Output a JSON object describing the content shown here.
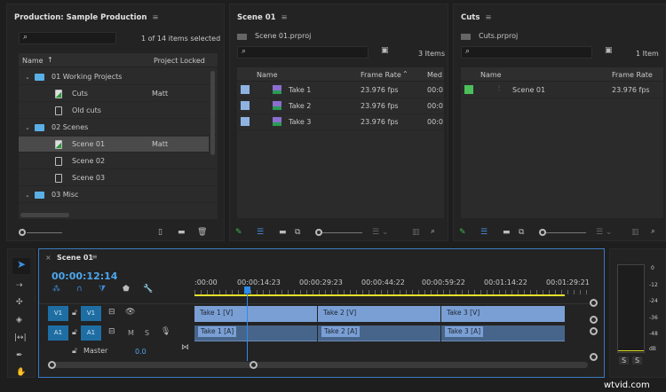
{
  "project_panel": {
    "title": "Production: Sample Production",
    "status": "1 of 14 items selected",
    "columns": [
      "Name",
      "Project Locked"
    ],
    "items": [
      {
        "label": "01 Working Projects",
        "type": "folder",
        "locked": ""
      },
      {
        "label": "Cuts",
        "type": "project-locked",
        "locked": "Matt"
      },
      {
        "label": "Old cuts",
        "type": "project",
        "locked": ""
      },
      {
        "label": "02 Scenes",
        "type": "folder",
        "locked": ""
      },
      {
        "label": "Scene 01",
        "type": "project-locked",
        "locked": "Matt",
        "selected": true
      },
      {
        "label": "Scene 02",
        "type": "project",
        "locked": ""
      },
      {
        "label": "Scene 03",
        "type": "project",
        "locked": ""
      },
      {
        "label": "03 Misc",
        "type": "folder",
        "locked": ""
      }
    ]
  },
  "scene_panel": {
    "title": "Scene 01",
    "file": "Scene 01.prproj",
    "count": "3 Items",
    "columns": [
      "Name",
      "Frame Rate",
      "Med"
    ],
    "rows": [
      {
        "name": "Take 1",
        "fps": "23.976 fps",
        "media": "00:0"
      },
      {
        "name": "Take 2",
        "fps": "23.976 fps",
        "media": "00:0"
      },
      {
        "name": "Take 3",
        "fps": "23.976 fps",
        "media": "00:0"
      }
    ],
    "label_color": "#8fb3e0"
  },
  "cuts_panel": {
    "title": "Cuts",
    "file": "Cuts.prproj",
    "count": "1 Item",
    "columns": [
      "Name",
      "Frame Rate"
    ],
    "rows": [
      {
        "name": "Scene 01",
        "fps": "23.976 fps"
      }
    ],
    "label_color": "#4cbf5a"
  },
  "timeline": {
    "tab": "Scene 01",
    "close": "×",
    "timecode": "00:00:12:14",
    "ruler": [
      ":00:00",
      "00:00:14:23",
      "00:00:29:23",
      "00:00:44:22",
      "00:00:59:22",
      "00:01:14:22",
      "00:01:29:21"
    ],
    "tracks": {
      "v1_src": "V1",
      "v1": "V1",
      "a1_src": "A1",
      "a1": "A1",
      "m": "M",
      "s": "S",
      "master": "Master",
      "master_value": "0.0"
    },
    "video_clips": [
      "Take 1 [V]",
      "Take 2 [V]",
      "Take 3 [V]"
    ],
    "audio_clips": [
      "Take 1 [A]",
      "Take 2 [A]",
      "Take 3 [A]"
    ],
    "accent": "#2d8ceb",
    "work_area_color": "#e5e02a"
  },
  "meter": {
    "scale": [
      "0",
      "-12",
      "-24",
      "-36",
      "-48",
      "dB"
    ],
    "solo": [
      "S",
      "S"
    ]
  },
  "watermark": "wtvid.com"
}
